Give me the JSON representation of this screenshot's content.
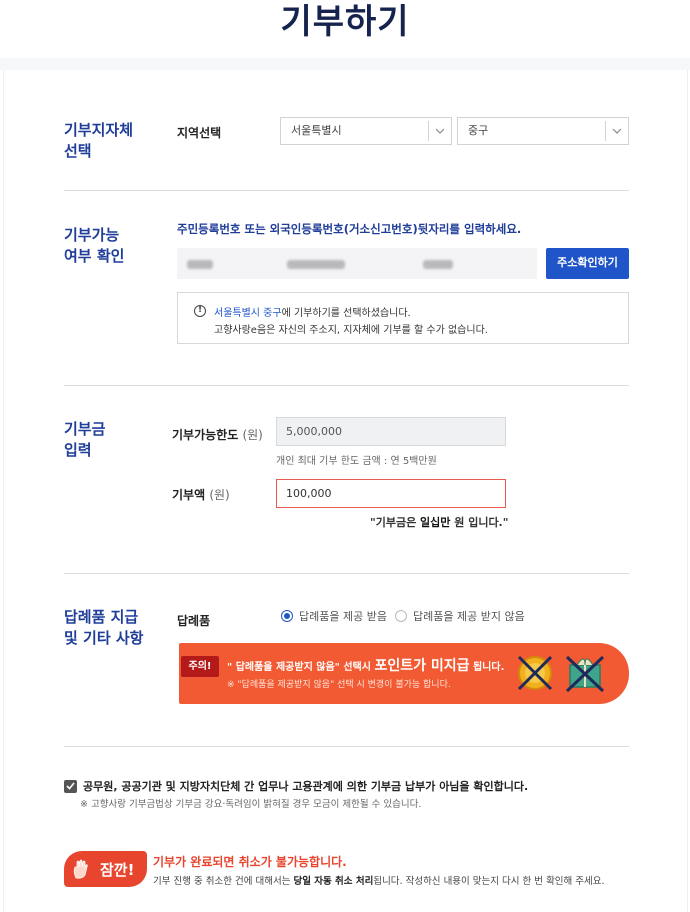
{
  "page": {
    "title": "기부하기"
  },
  "region": {
    "section_title": "기부지자체\n선택",
    "label": "지역선택",
    "province": "서울특별시",
    "district": "중구"
  },
  "eligibility": {
    "section_title": "기부가능\n여부 확인",
    "instruction": "주민등록번호 또는 외국인등록번호(거소신고번호)뒷자리를 입력하세요.",
    "button_label": "주소확인하기",
    "notice": {
      "region_highlight": "서울특별시 중구",
      "line1_suffix": "에 기부하기를 선택하셨습니다.",
      "line2": "고향사랑e음은 자신의 주소지, 지자체에 기부를 할 수가 없습니다."
    }
  },
  "amount": {
    "section_title": "기부금\n입력",
    "limit_label": "기부가능한도",
    "limit_unit": "(원)",
    "limit_value": "5,000,000",
    "limit_hint": "개인 최대 기부 한도 금액 : 연 5백만원",
    "donation_label": "기부액",
    "donation_unit": "(원)",
    "donation_value": "100,000",
    "readout_prefix": "\"기부금은 ",
    "readout_amount": "일십만",
    "readout_suffix": " 원 입니다.\""
  },
  "gift": {
    "section_title": "답례품 지급\n및 기타 사항",
    "label": "답례품",
    "option_receive": "답례품을 제공 받음",
    "option_decline": "답례품을 제공 받지 않음",
    "selected": "답례품을 제공 받음",
    "banner": {
      "tag": "주의!",
      "line1_prefix": "\" 답례품을 제공받지 않음\" 선택시 ",
      "line1_emphasis": "포인트가 미지급",
      "line1_suffix": " 됩니다.",
      "line2": "※ \"답례품을 제공받지 않음\" 선택 시 변경이 불가능 합니다."
    }
  },
  "confirm": {
    "checked": true,
    "text": "공무원, 공공기관 및 지방자치단체 간 업무나 고용관계에 의한 기부금 납부가 아님을 확인합니다.",
    "subtext": "※ 고향사랑 기부금법상 기부금 강요·독려임이 밝혀질 경우 모금이 제한될 수 있습니다."
  },
  "caution": {
    "badge": "잠깐!",
    "title": "기부가 완료되면 취소가 불가능합니다.",
    "sub_prefix": "기부 진행 중 취소한 건에 대해서는 ",
    "sub_emphasis": "당일 자동 취소 처리",
    "sub_suffix": "됩니다. 작성하신 내용이 맞는지 다시 한 번 확인해 주세요."
  },
  "colors": {
    "brand_navy": "#16234e",
    "accent_blue": "#1f55c9",
    "warning_orange": "#f25a33",
    "caution_red": "#e8452f"
  }
}
